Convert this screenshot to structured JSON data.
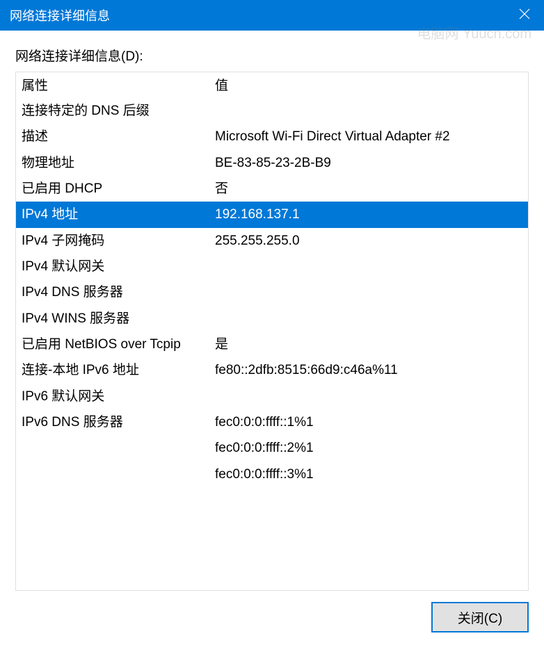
{
  "window": {
    "title": "网络连接详细信息",
    "watermark": "电脑网 Yuucn.com"
  },
  "section_label": "网络连接详细信息(D):",
  "table": {
    "header_prop": "属性",
    "header_val": "值",
    "rows": [
      {
        "prop": "连接特定的 DNS 后缀",
        "val": "",
        "selected": false
      },
      {
        "prop": "描述",
        "val": "Microsoft Wi-Fi Direct Virtual Adapter #2",
        "selected": false
      },
      {
        "prop": "物理地址",
        "val": "BE-83-85-23-2B-B9",
        "selected": false
      },
      {
        "prop": "已启用 DHCP",
        "val": "否",
        "selected": false
      },
      {
        "prop": "IPv4 地址",
        "val": "192.168.137.1",
        "selected": true
      },
      {
        "prop": "IPv4 子网掩码",
        "val": "255.255.255.0",
        "selected": false
      },
      {
        "prop": "IPv4 默认网关",
        "val": "",
        "selected": false
      },
      {
        "prop": "IPv4 DNS 服务器",
        "val": "",
        "selected": false
      },
      {
        "prop": "IPv4 WINS 服务器",
        "val": "",
        "selected": false
      },
      {
        "prop": "已启用 NetBIOS over Tcpip",
        "val": "是",
        "selected": false
      },
      {
        "prop": "连接-本地 IPv6 地址",
        "val": "fe80::2dfb:8515:66d9:c46a%11",
        "selected": false
      },
      {
        "prop": "IPv6 默认网关",
        "val": "",
        "selected": false
      },
      {
        "prop": "IPv6 DNS 服务器",
        "val": "fec0:0:0:ffff::1%1",
        "selected": false
      },
      {
        "prop": "",
        "val": "fec0:0:0:ffff::2%1",
        "selected": false
      },
      {
        "prop": "",
        "val": "fec0:0:0:ffff::3%1",
        "selected": false
      }
    ]
  },
  "footer": {
    "close_label": "关闭(C)"
  }
}
